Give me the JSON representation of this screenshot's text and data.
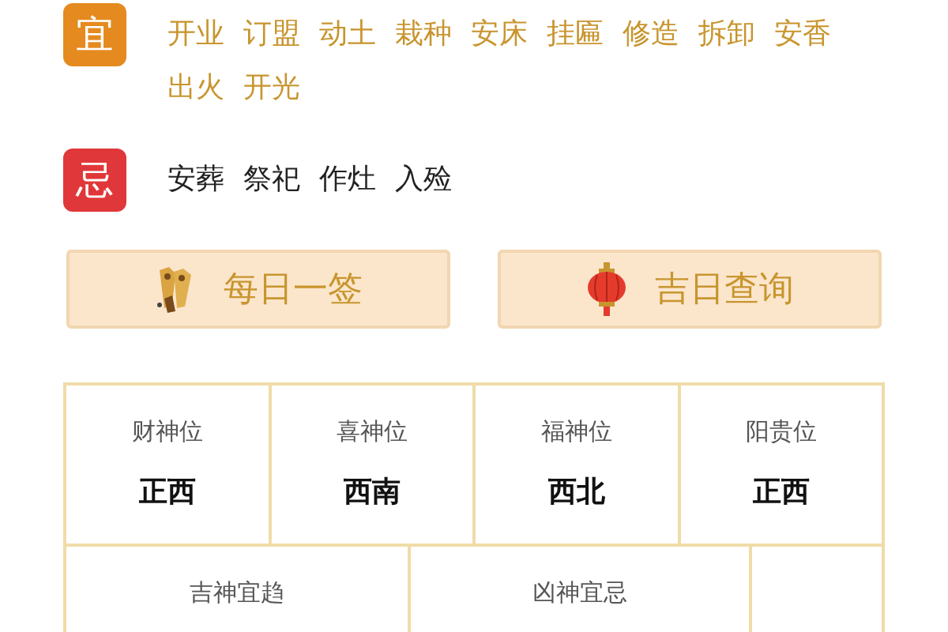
{
  "sections": [
    {
      "kind": "yi",
      "badge": "宜",
      "items": [
        "开业",
        "订盟",
        "动土",
        "栽种",
        "安床",
        "挂匾",
        "修造",
        "拆卸",
        "安香",
        "出火",
        "开光"
      ]
    },
    {
      "kind": "ji",
      "badge": "忌",
      "items": [
        "安葬",
        "祭祀",
        "作灶",
        "入殓"
      ]
    }
  ],
  "buttons": [
    {
      "kind": "sticks",
      "label": "每日一签"
    },
    {
      "kind": "lantern",
      "label": "吉日查询"
    }
  ],
  "positions": [
    {
      "label": "财神位",
      "value": "正西"
    },
    {
      "label": "喜神位",
      "value": "西南"
    },
    {
      "label": "福神位",
      "value": "西北"
    },
    {
      "label": "阳贵位",
      "value": "正西"
    }
  ],
  "spirits": [
    {
      "label": "吉神宜趋"
    },
    {
      "label": "凶神宜忌"
    }
  ]
}
